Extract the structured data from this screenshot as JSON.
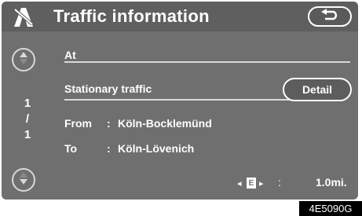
{
  "header": {
    "title": "Traffic information",
    "nav_icon": "navigation-road-icon",
    "back_icon": "return-arrow-icon"
  },
  "scroll": {
    "up_icon": "scroll-up-icon",
    "down_icon": "scroll-down-icon"
  },
  "page_counter": {
    "current": "1",
    "separator": "/",
    "total": "1"
  },
  "info": {
    "at_label": "At",
    "cause": "Stationary traffic",
    "detail_label": "Detail",
    "from_label": "From",
    "from_colon": ":",
    "from_value": "Köln-Bocklemünd",
    "to_label": "To",
    "to_colon": ":",
    "to_value": "Köln-Lövenich"
  },
  "distance": {
    "direction_left": "◂",
    "direction_box": "E",
    "direction_right": "▸",
    "colon": ":",
    "value": "1.0mi."
  },
  "image_code": "4E5090G"
}
